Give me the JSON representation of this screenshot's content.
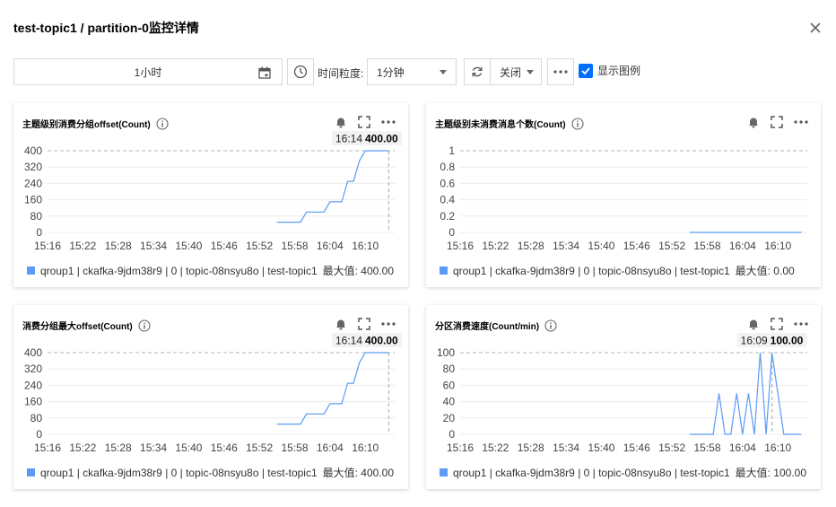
{
  "dialog": {
    "title": "test-topic1 / partition-0监控详情"
  },
  "toolbar": {
    "time_range": "1小时",
    "granularity_label": "时间粒度:",
    "granularity_value": "1分钟",
    "auto_refresh_value": "关闭",
    "show_legend_label": "显示图例",
    "show_legend_checked": true
  },
  "colors": {
    "accent": "#006eff",
    "series": "#5b9bf5"
  },
  "icons": [
    "close-icon",
    "calendar-icon",
    "clock-icon",
    "refresh-icon",
    "more-icon",
    "check-icon",
    "info-icon",
    "bell-icon",
    "fullscreen-icon"
  ],
  "charts": [
    {
      "title": "主题级别消费分组offset(Count)",
      "legend_name": "qroup1 | ckafka-9jdm38r9 | 0 | topic-08nsyu8o | test-topic1",
      "max_label": "最大值: 400.00",
      "tooltip_time": "16:14",
      "tooltip_value": "400.00"
    },
    {
      "title": "主题级别未消费消息个数(Count)",
      "legend_name": "qroup1 | ckafka-9jdm38r9 | 0 | topic-08nsyu8o | test-topic1",
      "max_label": "最大值: 0.00"
    },
    {
      "title": "消费分组最大offset(Count)",
      "legend_name": "qroup1 | ckafka-9jdm38r9 | 0 | topic-08nsyu8o | test-topic1",
      "max_label": "最大值: 400.00",
      "tooltip_time": "16:14",
      "tooltip_value": "400.00"
    },
    {
      "title": "分区消费速度(Count/min)",
      "legend_name": "qroup1 | ckafka-9jdm38r9 | 0 | topic-08nsyu8o | test-topic1",
      "max_label": "最大值: 100.00",
      "tooltip_time": "16:09",
      "tooltip_value": "100.00"
    }
  ],
  "chart_data": [
    {
      "type": "line",
      "title": "主题级别消费分组offset(Count)",
      "x_tick_labels": [
        "15:16",
        "15:22",
        "15:28",
        "15:34",
        "15:40",
        "15:46",
        "15:52",
        "15:58",
        "16:04",
        "16:10"
      ],
      "y_ticks": [
        0,
        80,
        160,
        240,
        320,
        400
      ],
      "ylim": [
        0,
        400
      ],
      "xlim": [
        "15:16",
        "16:15"
      ],
      "grid": true,
      "legend_position": "bottom",
      "series": [
        {
          "name": "qroup1 | ckafka-9jdm38r9 | 0 | topic-08nsyu8o | test-topic1",
          "x": [
            "15:55",
            "15:56",
            "15:57",
            "15:58",
            "15:59",
            "16:00",
            "16:01",
            "16:02",
            "16:03",
            "16:04",
            "16:05",
            "16:06",
            "16:07",
            "16:08",
            "16:09",
            "16:10",
            "16:11",
            "16:12",
            "16:13",
            "16:14"
          ],
          "y": [
            50,
            50,
            50,
            50,
            50,
            100,
            100,
            100,
            100,
            150,
            150,
            150,
            250,
            250,
            350,
            400,
            400,
            400,
            400,
            400
          ]
        }
      ]
    },
    {
      "type": "line",
      "title": "主题级别未消费消息个数(Count)",
      "x_tick_labels": [
        "15:16",
        "15:22",
        "15:28",
        "15:34",
        "15:40",
        "15:46",
        "15:52",
        "15:58",
        "16:04",
        "16:10"
      ],
      "y_ticks": [
        0,
        0.2,
        0.4,
        0.6,
        0.8,
        1
      ],
      "ylim": [
        0,
        1
      ],
      "xlim": [
        "15:16",
        "16:15"
      ],
      "grid": true,
      "legend_position": "bottom",
      "series": [
        {
          "name": "qroup1 | ckafka-9jdm38r9 | 0 | topic-08nsyu8o | test-topic1",
          "x": [
            "15:55",
            "16:14"
          ],
          "y": [
            0,
            0
          ]
        }
      ]
    },
    {
      "type": "line",
      "title": "消费分组最大offset(Count)",
      "x_tick_labels": [
        "15:16",
        "15:22",
        "15:28",
        "15:34",
        "15:40",
        "15:46",
        "15:52",
        "15:58",
        "16:04",
        "16:10"
      ],
      "y_ticks": [
        0,
        80,
        160,
        240,
        320,
        400
      ],
      "ylim": [
        0,
        400
      ],
      "xlim": [
        "15:16",
        "16:15"
      ],
      "grid": true,
      "legend_position": "bottom",
      "series": [
        {
          "name": "qroup1 | ckafka-9jdm38r9 | 0 | topic-08nsyu8o | test-topic1",
          "x": [
            "15:55",
            "15:56",
            "15:57",
            "15:58",
            "15:59",
            "16:00",
            "16:01",
            "16:02",
            "16:03",
            "16:04",
            "16:05",
            "16:06",
            "16:07",
            "16:08",
            "16:09",
            "16:10",
            "16:11",
            "16:12",
            "16:13",
            "16:14"
          ],
          "y": [
            50,
            50,
            50,
            50,
            50,
            100,
            100,
            100,
            100,
            150,
            150,
            150,
            250,
            250,
            350,
            400,
            400,
            400,
            400,
            400
          ]
        }
      ]
    },
    {
      "type": "line",
      "title": "分区消费速度(Count/min)",
      "x_tick_labels": [
        "15:16",
        "15:22",
        "15:28",
        "15:34",
        "15:40",
        "15:46",
        "15:52",
        "15:58",
        "16:04",
        "16:10"
      ],
      "y_ticks": [
        0,
        20,
        40,
        60,
        80,
        100
      ],
      "ylim": [
        0,
        100
      ],
      "xlim": [
        "15:16",
        "16:15"
      ],
      "grid": true,
      "legend_position": "bottom",
      "series": [
        {
          "name": "qroup1 | ckafka-9jdm38r9 | 0 | topic-08nsyu8o | test-topic1",
          "x": [
            "15:55",
            "15:56",
            "15:57",
            "15:58",
            "15:59",
            "16:00",
            "16:01",
            "16:02",
            "16:03",
            "16:04",
            "16:05",
            "16:06",
            "16:07",
            "16:08",
            "16:09",
            "16:10",
            "16:11",
            "16:12",
            "16:13",
            "16:14"
          ],
          "y": [
            0,
            0,
            0,
            0,
            0,
            50,
            0,
            0,
            50,
            0,
            50,
            0,
            100,
            0,
            100,
            50,
            0,
            0,
            0,
            0
          ]
        }
      ]
    }
  ]
}
